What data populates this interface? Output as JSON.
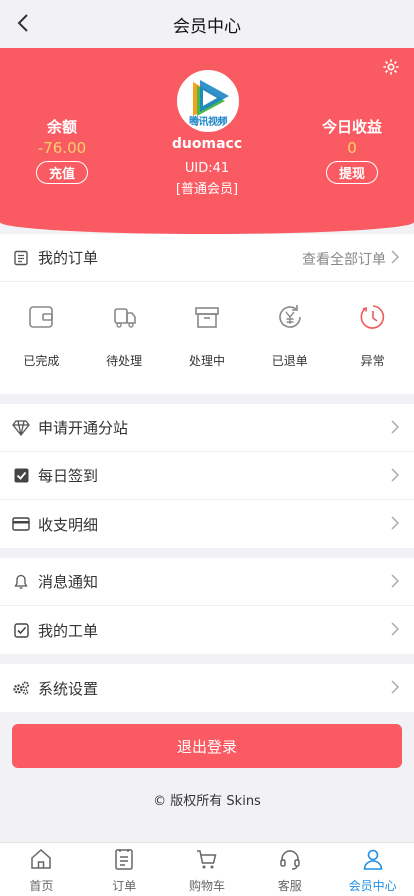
{
  "header": {
    "title": "会员中心"
  },
  "profile": {
    "balance_label": "余额",
    "balance_value": "-76.00",
    "recharge_label": "充值",
    "avatar_watermark": "腾讯视频",
    "username": "duomacc",
    "uid": "UID:41",
    "level": "[普通会员]",
    "earnings_label": "今日收益",
    "earnings_value": "0",
    "withdraw_label": "提现"
  },
  "orders": {
    "title": "我的订单",
    "view_all": "查看全部订单",
    "statuses": [
      {
        "label": "已完成",
        "icon": "wallet-icon"
      },
      {
        "label": "待处理",
        "icon": "truck-icon"
      },
      {
        "label": "处理中",
        "icon": "box-icon"
      },
      {
        "label": "已退单",
        "icon": "refund-icon"
      },
      {
        "label": "异常",
        "icon": "clock-icon"
      }
    ]
  },
  "menu_group1": [
    {
      "label": "申请开通分站",
      "icon": "diamond-icon"
    },
    {
      "label": "每日签到",
      "icon": "checkbox-icon"
    },
    {
      "label": "收支明细",
      "icon": "card-icon"
    }
  ],
  "menu_group2": [
    {
      "label": "消息通知",
      "icon": "bell-icon"
    },
    {
      "label": "我的工单",
      "icon": "ticket-icon"
    }
  ],
  "menu_group3": [
    {
      "label": "系统设置",
      "icon": "gears-icon"
    }
  ],
  "logout_label": "退出登录",
  "copyright": "© 版权所有 Skins",
  "tabs": [
    {
      "label": "首页",
      "icon": "home-icon"
    },
    {
      "label": "订单",
      "icon": "orders-icon"
    },
    {
      "label": "购物车",
      "icon": "cart-icon"
    },
    {
      "label": "客服",
      "icon": "headset-icon"
    },
    {
      "label": "会员中心",
      "icon": "user-icon",
      "active": true
    }
  ],
  "colors": {
    "accent": "#fa5a62",
    "highlight": "#f6d26b",
    "tab_active": "#1f8fe5"
  }
}
